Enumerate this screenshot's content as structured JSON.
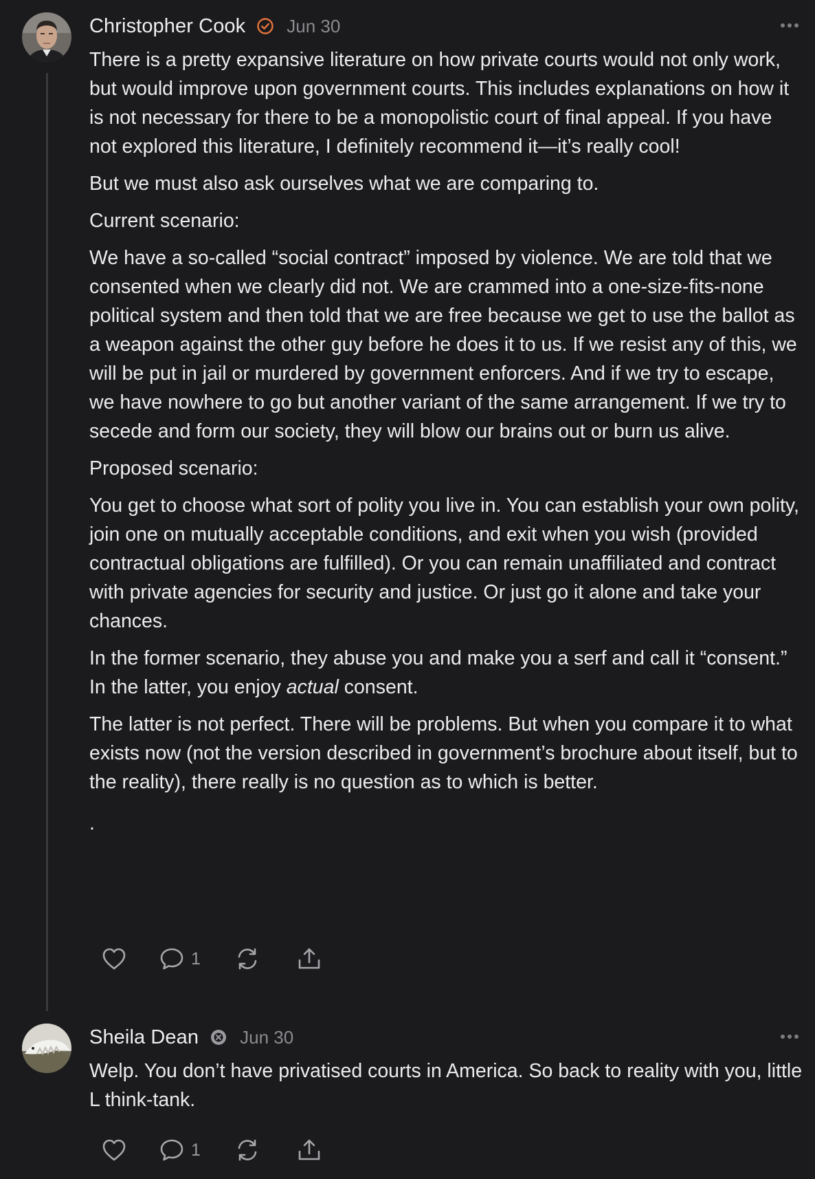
{
  "comments": [
    {
      "author": "Christopher Cook",
      "date": "Jun 30",
      "badge_icon": "check-badge-icon",
      "badge_color": "#e8743b",
      "paragraphs": [
        "There is a pretty expansive literature on how private courts would not only work, but would improve upon government courts. This includes explanations on how it is not necessary for there to be a monopolistic court of final appeal. If you have not explored this literature, I definitely recommend it—it’s really cool!",
        "But we must also ask ourselves what we are comparing to.",
        "Current scenario:",
        "We have a so-called “social contract” imposed by violence. We are told that we consented when we clearly did not. We are crammed into a one-size-fits-none political system and then told that we are free because we get to use the ballot as a weapon against the other guy before he does it to us. If we resist any of this, we will be put in jail or murdered by government enforcers. And if we try to escape, we have nowhere to go but another variant of the same arrangement. If we try to secede and form our society, they will blow our brains out or burn us alive.",
        "Proposed scenario:",
        "You get to choose what sort of polity you live in. You can establish your own polity, join one on mutually acceptable conditions, and exit when you wish (provided contractual obligations are fulfilled). Or you can remain unaffiliated and contract with private agencies for security and justice. Or just go it alone and take your chances."
      ],
      "para7": {
        "before": "In the former scenario, they abuse you and make you a serf and call it “consent.” In the latter, you enjoy ",
        "emphasis": "actual",
        "after": " consent."
      },
      "para8": "The latter is not perfect. There will be problems. But when you compare it to what exists now (not the version described in government’s brochure about itself, but to the reality), there really is no question as to which is better.",
      "para9": ".",
      "reply_count": "1"
    },
    {
      "author": "Sheila Dean",
      "date": "Jun 30",
      "badge_icon": "emblem-badge-icon",
      "badge_color": "#9a9a9f",
      "paragraphs": [
        "Welp. You don’t have privatised courts in America. So back to reality with you, little L think-tank."
      ],
      "reply_count": "1"
    }
  ],
  "colors": {
    "background": "#1b1b1e",
    "text": "#ececee",
    "muted": "#8b8b90",
    "thread_line": "#3a3a3e"
  }
}
